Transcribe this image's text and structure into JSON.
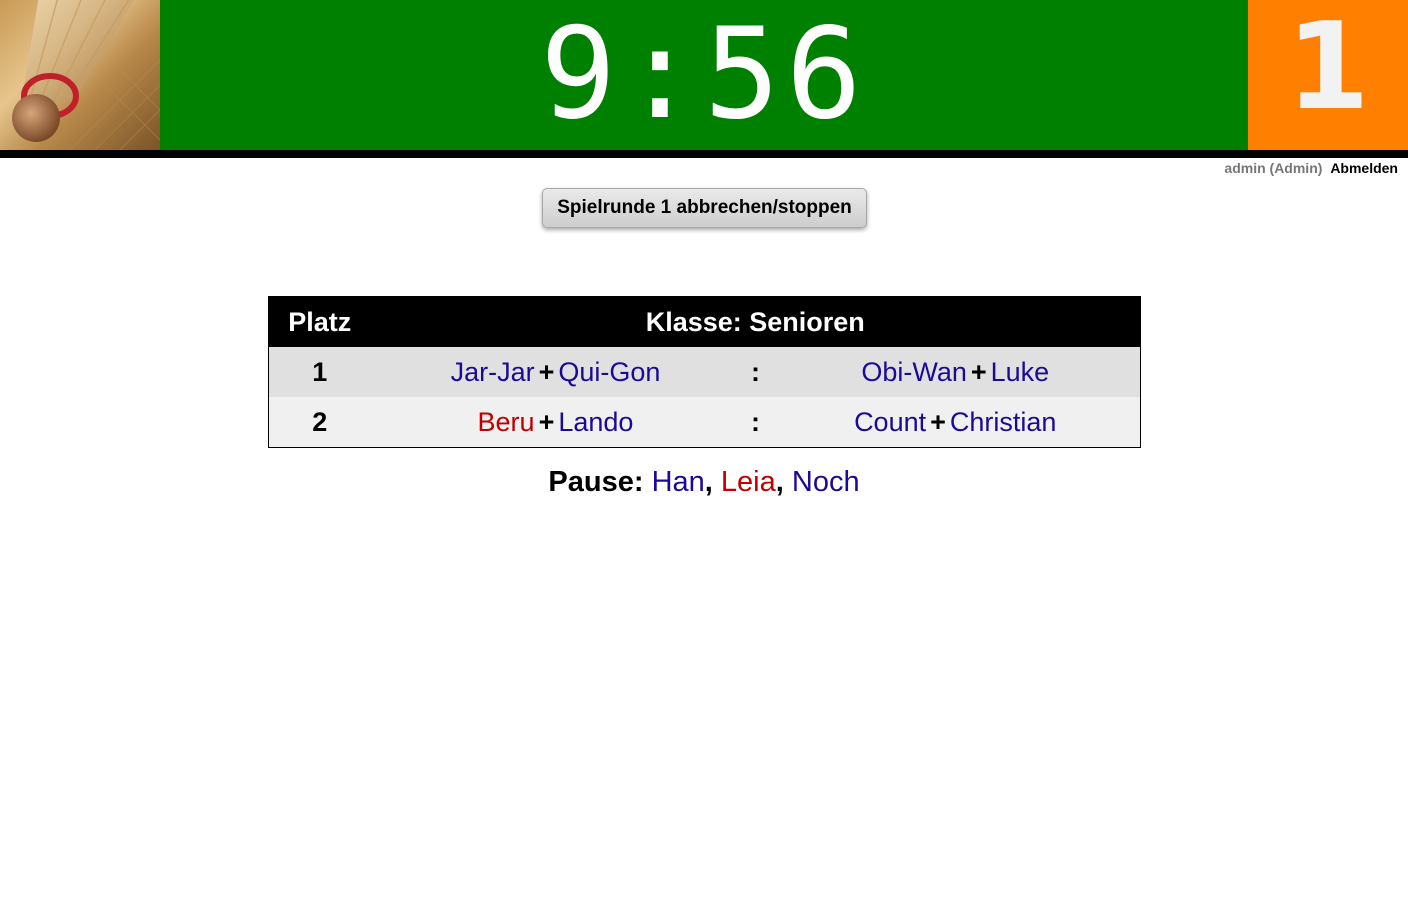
{
  "header": {
    "timer": "9:56",
    "round_number": "1",
    "colors": {
      "timer_band": "#008000",
      "round_box": "#ff8000"
    }
  },
  "user": {
    "name": "admin (Admin)",
    "logout_label": "Abmelden"
  },
  "actions": {
    "stop_round_label": "Spielrunde 1 abbrechen/stoppen"
  },
  "table": {
    "header_place": "Platz",
    "header_class": "Klasse: Senioren",
    "separator": ":",
    "plus": "+",
    "rows": [
      {
        "place": "1",
        "team_a": [
          {
            "name": "Jar-Jar",
            "color": "blue"
          },
          {
            "name": "Qui-Gon",
            "color": "blue"
          }
        ],
        "team_b": [
          {
            "name": "Obi-Wan",
            "color": "blue"
          },
          {
            "name": "Luke",
            "color": "blue"
          }
        ]
      },
      {
        "place": "2",
        "team_a": [
          {
            "name": "Beru",
            "color": "red"
          },
          {
            "name": "Lando",
            "color": "blue"
          }
        ],
        "team_b": [
          {
            "name": "Count",
            "color": "blue"
          },
          {
            "name": "Christian",
            "color": "blue"
          }
        ]
      }
    ]
  },
  "pause": {
    "label": "Pause:",
    "players": [
      {
        "name": "Han",
        "color": "blue"
      },
      {
        "name": "Leia",
        "color": "red"
      },
      {
        "name": "Noch",
        "color": "blue"
      }
    ]
  },
  "name_colors": {
    "blue": "#1a0a96",
    "red": "#c00000"
  }
}
